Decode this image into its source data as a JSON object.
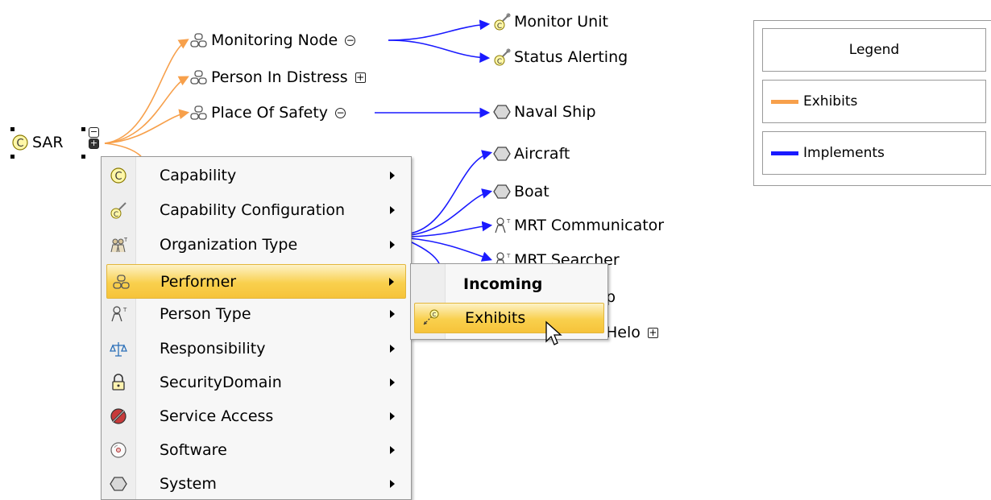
{
  "diagram": {
    "root": {
      "label": "SAR"
    },
    "exhibits_nodes": [
      {
        "label": "Monitoring Node",
        "toggle": "⊖"
      },
      {
        "label": "Person In Distress",
        "toggle": "⊕"
      },
      {
        "label": "Place Of Safety",
        "toggle": "⊖"
      }
    ],
    "implements_nodes": [
      {
        "label": "Monitor Unit"
      },
      {
        "label": "Status Alerting"
      },
      {
        "label": "Naval Ship"
      },
      {
        "label": "Aircraft"
      },
      {
        "label": "Boat"
      },
      {
        "label": "MRT Communicator"
      },
      {
        "label": "MRT Searcher"
      }
    ],
    "partial_labels": {
      "ship_tail": "p",
      "helo_tail": "Helo",
      "helo_toggle": "⊕"
    }
  },
  "legend": {
    "title": "Legend",
    "items": [
      {
        "label": "Exhibits",
        "color": "#f7a04b"
      },
      {
        "label": "Implements",
        "color": "#1a1aff"
      }
    ]
  },
  "context_menu": {
    "items": [
      {
        "label": "Capability",
        "icon": "capability-icon"
      },
      {
        "label": "Capability Configuration",
        "icon": "capability-configuration-icon"
      },
      {
        "label": "Organization Type",
        "icon": "organization-type-icon"
      },
      {
        "label": "Performer",
        "icon": "performer-icon",
        "highlighted": true
      },
      {
        "label": "Person Type",
        "icon": "person-type-icon"
      },
      {
        "label": "Responsibility",
        "icon": "responsibility-icon"
      },
      {
        "label": "SecurityDomain",
        "icon": "security-domain-icon"
      },
      {
        "label": "Service Access",
        "icon": "service-access-icon"
      },
      {
        "label": "Software",
        "icon": "software-icon"
      },
      {
        "label": "System",
        "icon": "system-icon"
      }
    ]
  },
  "submenu": {
    "header": "Incoming",
    "item": "Exhibits"
  },
  "colors": {
    "exhibits_edge": "#f7a04b",
    "implements_edge": "#1a1aff",
    "menu_highlight": "#f9d04d"
  }
}
